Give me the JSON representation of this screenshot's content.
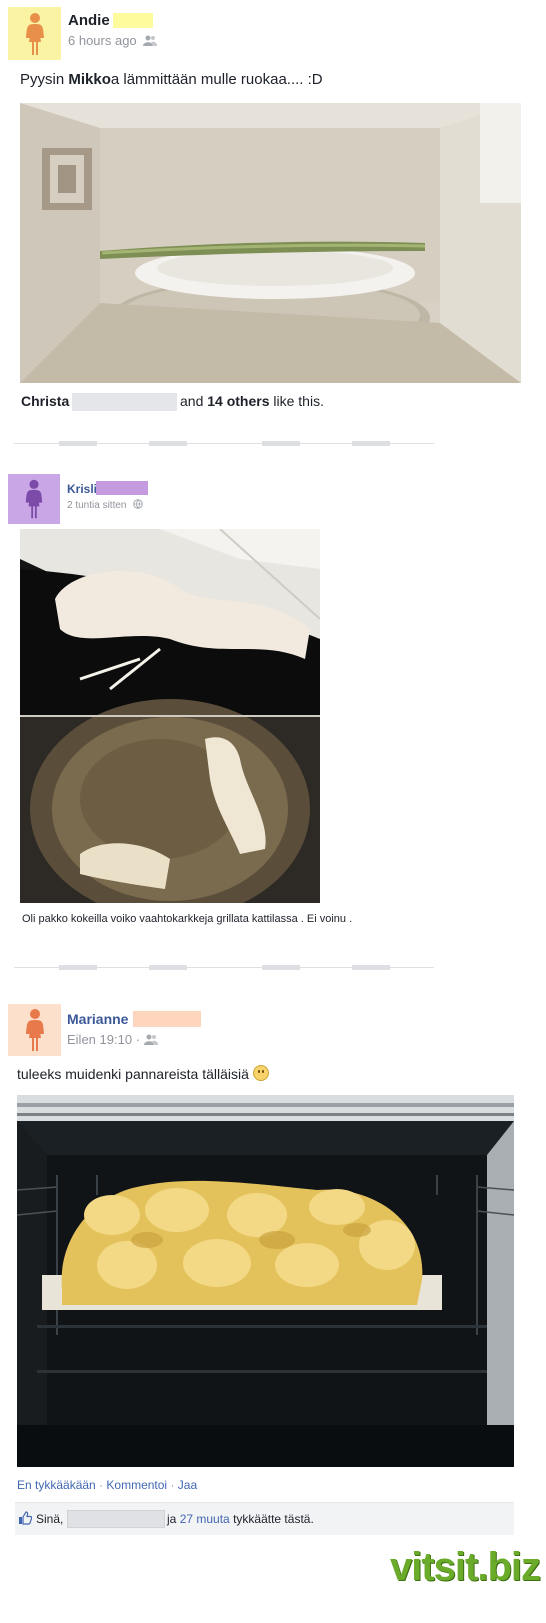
{
  "posts": [
    {
      "author_first": "Andie",
      "timestamp": "6 hours ago",
      "text_pre": "Pyysin ",
      "text_bold": "Mikko",
      "text_post": "a lämmittään mulle ruokaa.... :D",
      "likes_name": "Christa",
      "likes_middle": "and",
      "likes_count": "14 others",
      "likes_suffix": "like this."
    },
    {
      "author_first": "Krisli",
      "timestamp": "2 tuntia sitten",
      "caption": "Oli pakko kokeilla voiko vaahtokarkkeja grillata kattilassa . Ei voinu ."
    },
    {
      "author_first": "Marianne",
      "timestamp": "Eilen 19:10",
      "timestamp_sep": "·",
      "text": "tuleeks muidenki pannareista tälläisiä",
      "actions": [
        "En tykkääkään",
        "Kommentoi",
        "Jaa"
      ],
      "action_sep": "·",
      "likes_you": "Sinä,",
      "likes_middle": "ja",
      "likes_count": "27 muuta",
      "likes_suffix": "tykkäätte tästä."
    }
  ],
  "watermark": "vitsit.biz",
  "icons": {
    "avatar": "person-silhouette-icon",
    "audience": "friends-icon",
    "globe": "globe-icon",
    "like": "thumbs-up-icon",
    "smiley": "smiley-icon"
  },
  "colors": {
    "avatar_bg_1": "#fbf3a4",
    "avatar_bg_2": "#c9a6e6",
    "avatar_bg_3": "#fde0cc",
    "redact_yellow": "#fdfb9c",
    "redact_purple": "#c59be0",
    "redact_peach": "#fdd4bc",
    "redact_gray": "#e4e6ea",
    "link_blue": "#4267b2",
    "watermark_green": "#6aab2a"
  }
}
